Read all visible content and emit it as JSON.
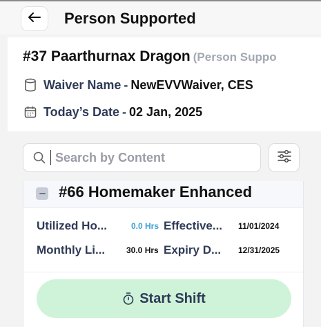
{
  "header": {
    "title": "Person Supported"
  },
  "person": {
    "name": "#37 Paarthurnax Dragon",
    "role": "(Person Suppo",
    "waiver_label": "Waiver Name",
    "waiver_value": "NewEVVWaiver, CES",
    "date_label": "Today’s Date",
    "date_value": "02 Jan, 2025",
    "separator": "-"
  },
  "search": {
    "placeholder": "Search by Content",
    "value": ""
  },
  "service": {
    "title": "#66 Homemaker Enhanced",
    "rows": [
      {
        "left_label": "Utilized Ho...",
        "left_value": "0.0 Hrs",
        "right_label": "Effective...",
        "right_value": "11/01/2024"
      },
      {
        "left_label": "Monthly Li...",
        "left_value": "30.0 Hrs",
        "right_label": "Expiry D...",
        "right_value": "12/31/2025"
      }
    ],
    "start_button_label": "Start Shift"
  },
  "icons": {
    "back": "arrow-left-icon",
    "waiver": "cylinder-icon",
    "date": "calendar-icon",
    "search": "search-icon",
    "filter": "sliders-icon",
    "checkbox": "minus-checkbox-icon",
    "start": "timer-icon"
  },
  "colors": {
    "accent_blue": "#3aa0d6",
    "start_button_bg": "#cff3d9",
    "label_navy": "#2f3a57",
    "muted_gray": "#a3a8b3"
  }
}
